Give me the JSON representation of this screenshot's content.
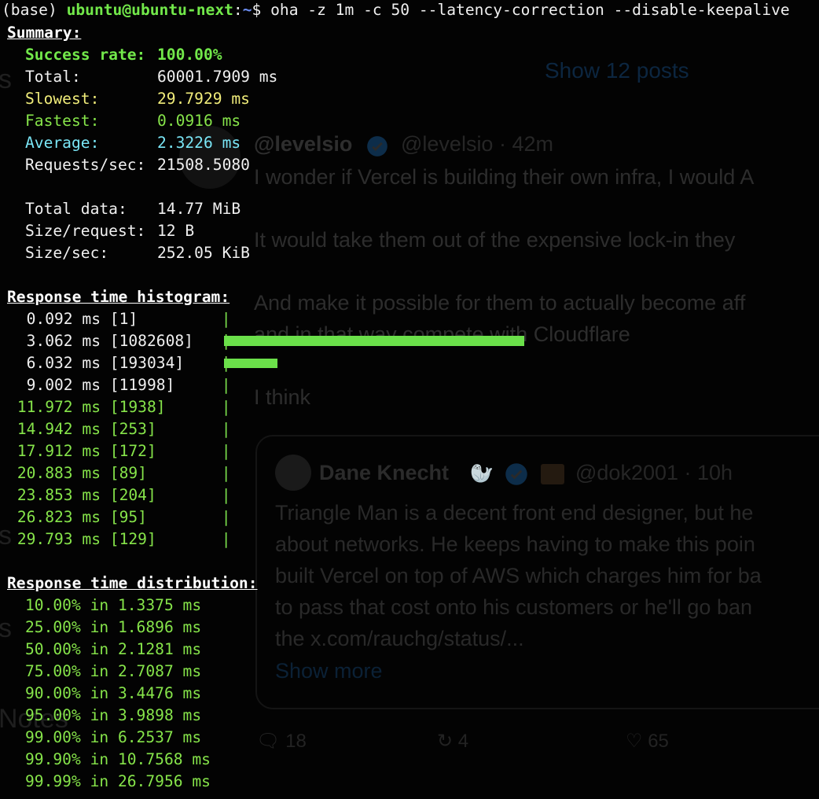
{
  "prompt": {
    "prefix": "(base) ",
    "user_host": "ubuntu@ubuntu-next",
    "colon": ":",
    "tilde": "~",
    "dollar": "$ ",
    "command": "oha -z 1m -c 50 --latency-correction --disable-keepalive"
  },
  "summary": {
    "header": "Summary:",
    "success_label": "Success rate:",
    "success_value": "100.00%",
    "total_label": "Total:",
    "total_value": "60001.7909 ms",
    "slowest_label": "Slowest:",
    "slowest_value": "29.7929 ms",
    "fastest_label": "Fastest:",
    "fastest_value": "0.0916 ms",
    "average_label": "Average:",
    "average_value": "2.3226 ms",
    "rps_label": "Requests/sec:",
    "rps_value": "21508.5080",
    "total_data_label": "Total data:",
    "total_data_value": "14.77 MiB",
    "size_req_label": "Size/request:",
    "size_req_value": "12 B",
    "size_sec_label": "Size/sec:",
    "size_sec_value": "252.05 KiB"
  },
  "histogram": {
    "header": "Response time histogram:",
    "rows": [
      {
        "bucket": "0.092 ms",
        "count": "[1]",
        "n": 1
      },
      {
        "bucket": "3.062 ms",
        "count": "[1082608]",
        "n": 1082608
      },
      {
        "bucket": "6.032 ms",
        "count": "[193034]",
        "n": 193034
      },
      {
        "bucket": "9.002 ms",
        "count": "[11998]",
        "n": 11998
      },
      {
        "bucket": "11.972 ms",
        "count": "[1938]",
        "n": 1938
      },
      {
        "bucket": "14.942 ms",
        "count": "[253]",
        "n": 253
      },
      {
        "bucket": "17.912 ms",
        "count": "[172]",
        "n": 172
      },
      {
        "bucket": "20.883 ms",
        "count": "[89]",
        "n": 89
      },
      {
        "bucket": "23.853 ms",
        "count": "[204]",
        "n": 204
      },
      {
        "bucket": "26.823 ms",
        "count": "[95]",
        "n": 95
      },
      {
        "bucket": "29.793 ms",
        "count": "[129]",
        "n": 129
      }
    ],
    "pipe": "|"
  },
  "distribution": {
    "header": "Response time distribution:",
    "rows": [
      {
        "pct": "10.00%",
        "sep": "in",
        "val": "1.3375 ms"
      },
      {
        "pct": "25.00%",
        "sep": "in",
        "val": "1.6896 ms"
      },
      {
        "pct": "50.00%",
        "sep": "in",
        "val": "2.1281 ms"
      },
      {
        "pct": "75.00%",
        "sep": "in",
        "val": "2.7087 ms"
      },
      {
        "pct": "90.00%",
        "sep": "in",
        "val": "3.4476 ms"
      },
      {
        "pct": "95.00%",
        "sep": "in",
        "val": "3.9898 ms"
      },
      {
        "pct": "99.00%",
        "sep": "in",
        "val": "6.2537 ms"
      },
      {
        "pct": "99.90%",
        "sep": "in",
        "val": "10.7568 ms"
      },
      {
        "pct": "99.99%",
        "sep": "in",
        "val": "26.7956 ms"
      }
    ]
  },
  "background_feed": {
    "show_posts": "Show 12 posts",
    "post": {
      "author": "@levelsio",
      "handle": "@levelsio · 42m",
      "lines": [
        "I wonder if Vercel is building their own infra, I would A",
        "It would take them out of the expensive lock-in they",
        "And make it possible for them to actually become aff",
        "and in that way compete with Cloudflare",
        "I think"
      ]
    },
    "quote": {
      "author": "Dane Knecht",
      "handle": "@dok2001 · 10h",
      "lines": [
        "Triangle Man is a decent front end designer, but he",
        "about networks. He keeps having to make this poin",
        "built Vercel on top of AWS which charges him for ba",
        "to pass that cost onto his customers or he'll go ban",
        "the x.com/rauchg/status/..."
      ],
      "show_more": "Show more"
    },
    "actions": {
      "replies": "18",
      "reposts": "4",
      "likes": "65"
    },
    "left_edge": [
      "s",
      "s",
      "s",
      "Notes"
    ]
  },
  "colors": {
    "background": "#030303",
    "green": "#86e44a",
    "bar": "#6be04a",
    "yellow": "#f0ec7a",
    "cyan": "#7ae6f6"
  }
}
